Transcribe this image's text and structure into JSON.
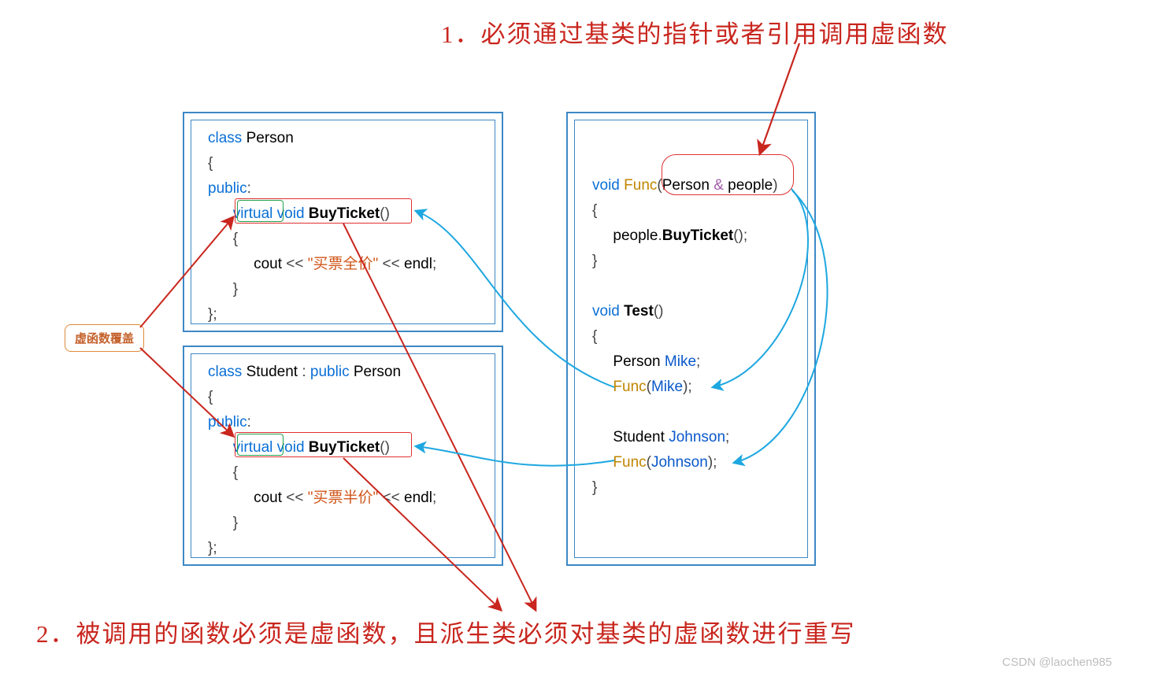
{
  "annotations": {
    "top": "1．必须通过基类的指针或者引用调用虚函数",
    "bottom": "2．被调用的函数必须是虚函数，且派生类必须对基类的虚函数进行重写",
    "badge": "虚函数覆盖"
  },
  "panels": {
    "person": {
      "line1_kw": "class",
      "line1_name": "Person",
      "brace_open": "{",
      "public": "public",
      "public_colon": ":",
      "virt_kw": "virtual",
      "void_kw": "void",
      "fn_name": "BuyTicket",
      "fn_parens": "()",
      "inner_open": "{",
      "cout": "cout",
      "lt1": "<<",
      "str": "\"买票全价\"",
      "lt2": "<<",
      "endl": "endl",
      "semi": ";",
      "inner_close": "}",
      "brace_close": "};"
    },
    "student": {
      "line1_kw": "class",
      "line1_name": "Student",
      "inherit_colon": ":",
      "inherit_kw": "public",
      "inherit_base": "Person",
      "brace_open": "{",
      "public": "public",
      "public_colon": ":",
      "virt_kw": "virtual",
      "void_kw": "void",
      "fn_name": "BuyTicket",
      "fn_parens": "()",
      "inner_open": "{",
      "cout": "cout",
      "lt1": "<<",
      "str": "\"买票半价\"",
      "lt2": "<<",
      "endl": "endl",
      "semi": ";",
      "inner_close": "}",
      "brace_close": "};"
    },
    "right": {
      "func_void": "void",
      "func_name": "Func",
      "func_lparen": "(",
      "func_ptype": "Person",
      "func_amp": "&",
      "func_pname": "people",
      "func_rparen": ")",
      "func_open": "{",
      "func_body_obj": "people",
      "func_body_dot": ".",
      "func_body_call": "BuyTicket",
      "func_body_pars": "();",
      "func_close": "}",
      "test_void": "void",
      "test_name": "Test",
      "test_parens": "()",
      "test_open": "{",
      "decl1_type": "Person",
      "decl1_name": "Mike",
      "decl1_semi": ";",
      "call1_fn": "Func",
      "call1_lparen": "(",
      "call1_arg": "Mike",
      "call1_rparen": ");",
      "decl2_type": "Student",
      "decl2_name": "Johnson",
      "decl2_semi": ";",
      "call2_fn": "Func",
      "call2_lparen": "(",
      "call2_arg": "Johnson",
      "call2_rparen": ");",
      "test_close": "}"
    }
  },
  "watermark": "CSDN @laochen985"
}
